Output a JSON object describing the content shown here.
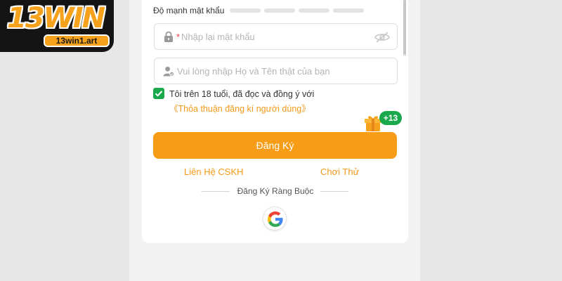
{
  "brand": {
    "name": "13WIN",
    "url": "13win1.art"
  },
  "password_strength": {
    "label": "Độ mạnh mật khẩu",
    "levels": 4,
    "filled": 0
  },
  "confirm_password": {
    "required_mark": "*",
    "placeholder": "Nhập lại mật khẩu",
    "value": ""
  },
  "real_name": {
    "placeholder": "Vui lòng nhập Họ và Tên thật của bạn",
    "value": ""
  },
  "agreement": {
    "checked": true,
    "text": "Tôi trên 18 tuổi, đã đọc và đồng ý với ",
    "link": "《Thỏa thuận đăng kí người dùng》"
  },
  "gift": {
    "badge": "+13",
    "icon": "gift-icon"
  },
  "register_button": {
    "label": "Đăng Ký"
  },
  "links": {
    "support": "Liên Hệ CSKH",
    "try": "Chơi Thử"
  },
  "bind_section": {
    "title": "Đăng Ký Ràng Buộc",
    "providers": [
      "google"
    ]
  },
  "colors": {
    "accent": "#F79C16",
    "link": "#F39A1A",
    "check": "#1AA84C",
    "required": "#F23B3B"
  }
}
